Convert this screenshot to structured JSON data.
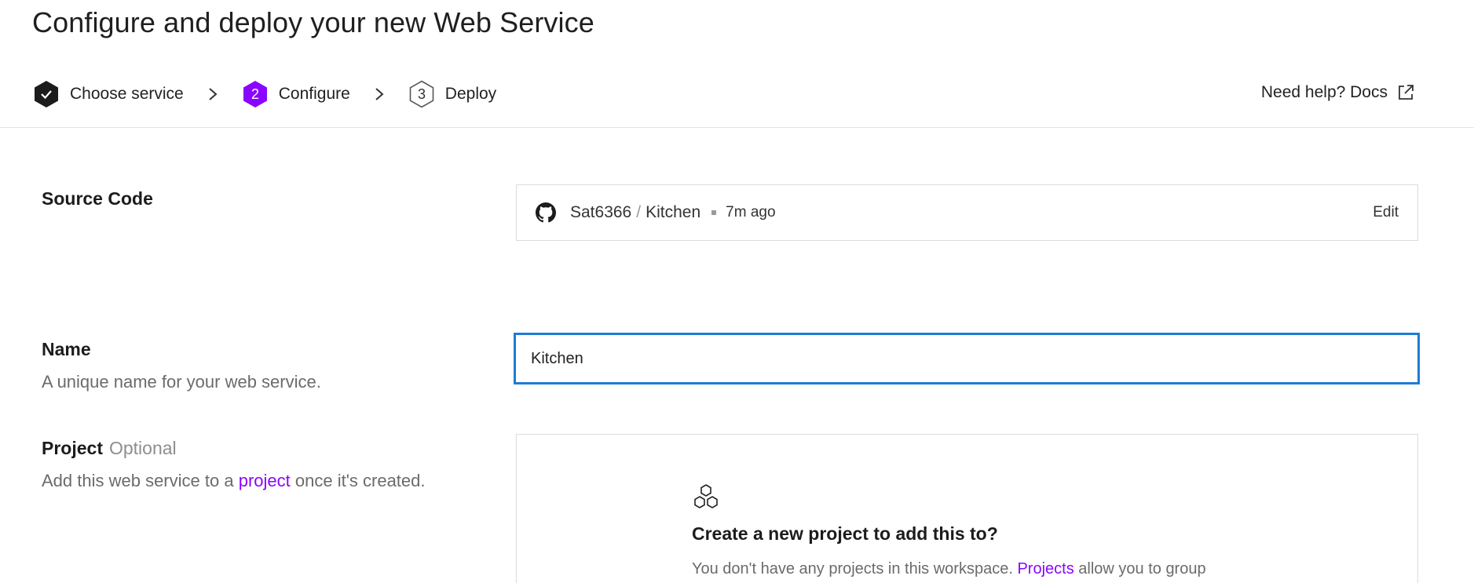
{
  "header": {
    "title": "Configure and deploy your new Web Service",
    "steps": [
      {
        "number": "",
        "label": "Choose service",
        "state": "done"
      },
      {
        "number": "2",
        "label": "Configure",
        "state": "active"
      },
      {
        "number": "3",
        "label": "Deploy",
        "state": "pending"
      }
    ],
    "help_label": "Need help? Docs"
  },
  "source_code": {
    "label": "Source Code",
    "owner": "Sat6366",
    "separator": "/",
    "repo": "Kitchen",
    "updated": "7m ago",
    "edit_label": "Edit"
  },
  "name": {
    "label": "Name",
    "description": "A unique name for your web service.",
    "value": "Kitchen"
  },
  "project": {
    "label": "Project",
    "optional_label": "Optional",
    "desc_prefix": "Add this web service to a",
    "desc_link": "project",
    "desc_suffix": "once it's created.",
    "empty_title": "Create a new project to add this to?",
    "empty_desc_prefix": "You don't have any projects in this workspace.",
    "empty_desc_link": "Projects",
    "empty_desc_suffix": "allow you to group"
  },
  "colors": {
    "accent": "#8a05ff",
    "focus": "#1d7cd6",
    "done": "#1c1c1c"
  },
  "icons": [
    "check-icon",
    "chevron-right-icon",
    "external-link-icon",
    "github-icon",
    "project-hexagons-icon"
  ]
}
